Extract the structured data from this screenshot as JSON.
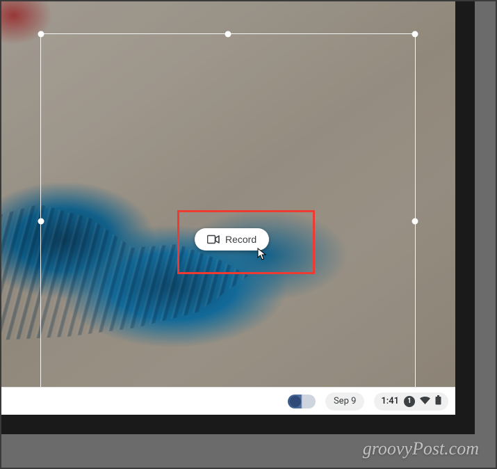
{
  "capture": {
    "button_label": "Record"
  },
  "taskbar": {
    "date_text": "Sep 9",
    "time_text": "1:41",
    "notification_count": "1"
  },
  "watermark": {
    "text": "groovyPost.com"
  },
  "colors": {
    "highlight": "#ed3b33",
    "button_bg": "#ffffff",
    "text": "#3c4043"
  }
}
